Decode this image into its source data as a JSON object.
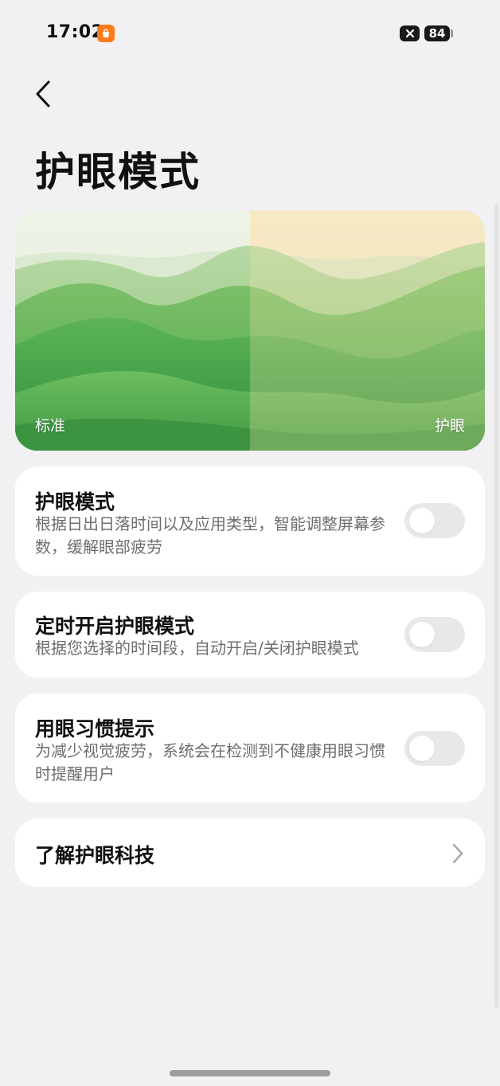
{
  "status_bar": {
    "time": "17:02",
    "battery": "84",
    "app_icon": "orange-shopping-bag-icon",
    "close_icon": "close-icon"
  },
  "header": {
    "title": "护眼模式",
    "back_icon": "chevron-left-icon"
  },
  "preview": {
    "left_label": "标准",
    "right_label": "护眼"
  },
  "settings": [
    {
      "title": "护眼模式",
      "description": "根据日出日落时间以及应用类型，智能调整屏幕参数，缓解眼部疲劳",
      "enabled": false
    },
    {
      "title": "定时开启护眼模式",
      "description": "根据您选择的时间段，自动开启/关闭护眼模式",
      "enabled": false
    },
    {
      "title": "用眼习惯提示",
      "description": "为减少视觉疲劳，系统会在检测到不健康用眼习惯时提醒用户",
      "enabled": false
    }
  ],
  "learn_more": {
    "label": "了解护眼科技",
    "icon": "chevron-right-icon"
  },
  "colors": {
    "background": "#f1f1f3",
    "card": "#ffffff",
    "toggle_off": "#e8e8ea",
    "badge_orange": "#ff7a1a"
  }
}
